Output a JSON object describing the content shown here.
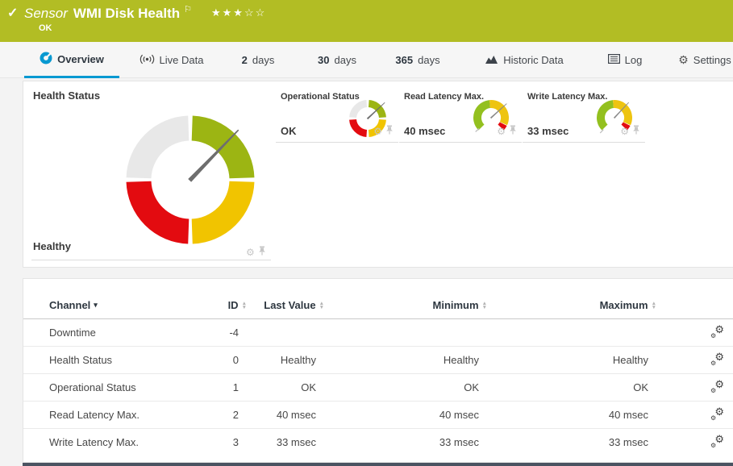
{
  "theme": {
    "header_green": "#b2bd24",
    "accent_blue": "#0899d1",
    "gauge_green": "#9cb513",
    "gauge_yellow": "#f1c400",
    "gauge_red": "#e30b10",
    "gauge_gray": "#e8e8e8",
    "footer_dark": "#4a5361"
  },
  "header": {
    "check_icon": "✓",
    "kind": "Sensor",
    "title": "WMI Disk Health",
    "flag_icon": "⚐",
    "stars": "★★★☆☆",
    "stars_filled": 3,
    "stars_total": 5,
    "status": "OK"
  },
  "tabs": [
    {
      "label": "Overview",
      "active": true
    },
    {
      "label": "Live Data"
    },
    {
      "num": "2",
      "label": "days"
    },
    {
      "num": "30",
      "label": "days"
    },
    {
      "num": "365",
      "label": "days"
    },
    {
      "label": "Historic Data"
    },
    {
      "label": "Log"
    },
    {
      "label": "Settings"
    }
  ],
  "gauges": {
    "health": {
      "title": "Health Status",
      "value": "Healthy",
      "needle_deg": 44
    },
    "operational": {
      "title": "Operational Status",
      "value": "OK",
      "needle_deg": 47
    },
    "read_latency": {
      "title": "Read Latency Max.",
      "value": "40 msec",
      "needle_deg": 48
    },
    "write_latency": {
      "title": "Write Latency Max.",
      "value": "33 msec",
      "needle_deg": 43
    }
  },
  "table": {
    "columns": {
      "channel": "Channel",
      "id": "ID",
      "last": "Last Value",
      "min": "Minimum",
      "max": "Maximum"
    },
    "rows": [
      {
        "channel": "Downtime",
        "id": "-4",
        "last": "",
        "min": "",
        "max": ""
      },
      {
        "channel": "Health Status",
        "id": "0",
        "last": "Healthy",
        "min": "Healthy",
        "max": "Healthy"
      },
      {
        "channel": "Operational Status",
        "id": "1",
        "last": "OK",
        "min": "OK",
        "max": "OK"
      },
      {
        "channel": "Read Latency Max.",
        "id": "2",
        "last": "40 msec",
        "min": "40 msec",
        "max": "40 msec"
      },
      {
        "channel": "Write Latency Max.",
        "id": "3",
        "last": "33 msec",
        "min": "33 msec",
        "max": "33 msec"
      }
    ]
  }
}
